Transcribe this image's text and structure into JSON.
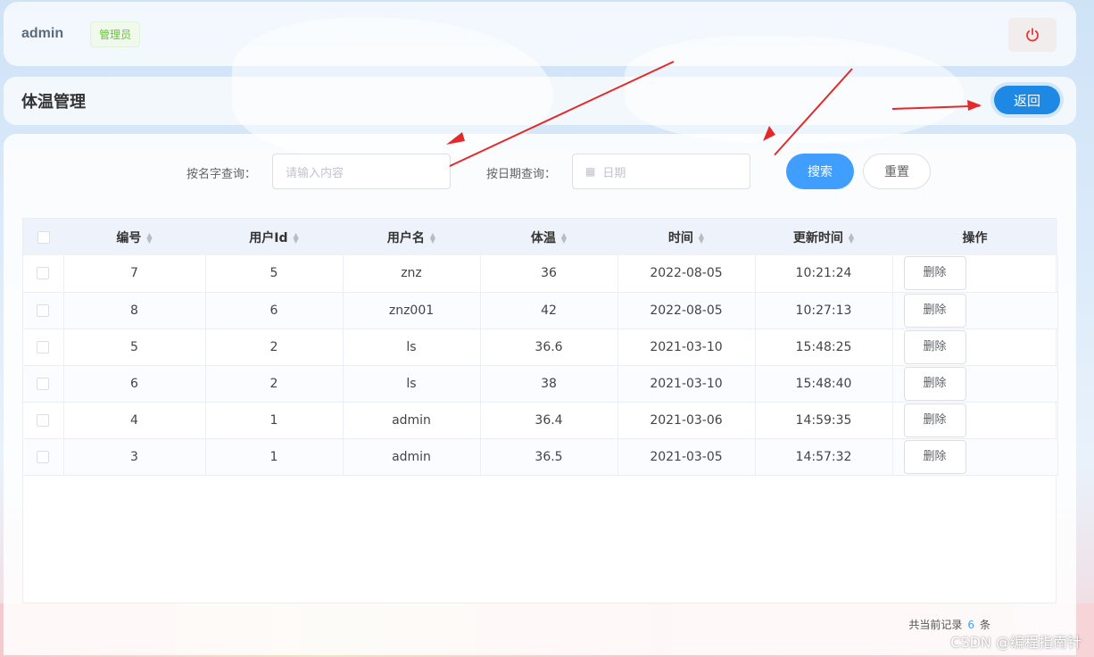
{
  "header": {
    "username": "admin",
    "role": "管理员",
    "logout_icon": "power-icon"
  },
  "page": {
    "title": "体温管理",
    "back_label": "返回"
  },
  "search": {
    "name_label": "按名字查询：",
    "name_placeholder": "请输入内容",
    "date_label": "按日期查询：",
    "date_placeholder": "日期",
    "search_label": "搜索",
    "reset_label": "重置"
  },
  "table": {
    "columns": [
      "编号",
      "用户Id",
      "用户名",
      "体温",
      "时间",
      "更新时间",
      "操作"
    ],
    "delete_label": "删除",
    "rows": [
      [
        "7",
        "5",
        "znz",
        "36",
        "2022-08-05",
        "10:21:24"
      ],
      [
        "8",
        "6",
        "znz001",
        "42",
        "2022-08-05",
        "10:27:13"
      ],
      [
        "5",
        "2",
        "ls",
        "36.6",
        "2021-03-10",
        "15:48:25"
      ],
      [
        "6",
        "2",
        "ls",
        "38",
        "2021-03-10",
        "15:48:40"
      ],
      [
        "4",
        "1",
        "admin",
        "36.4",
        "2021-03-06",
        "14:59:35"
      ],
      [
        "3",
        "1",
        "admin",
        "36.5",
        "2021-03-05",
        "14:57:32"
      ]
    ]
  },
  "footer": {
    "prefix": "共当前记录",
    "count": "6",
    "suffix": "条"
  },
  "watermark": "CSDN @编程指南针",
  "colors": {
    "primary": "#409eff",
    "back_button": "#1e88e5",
    "annotation_arrow": "#e32929",
    "role_tag": "#67c23a"
  }
}
